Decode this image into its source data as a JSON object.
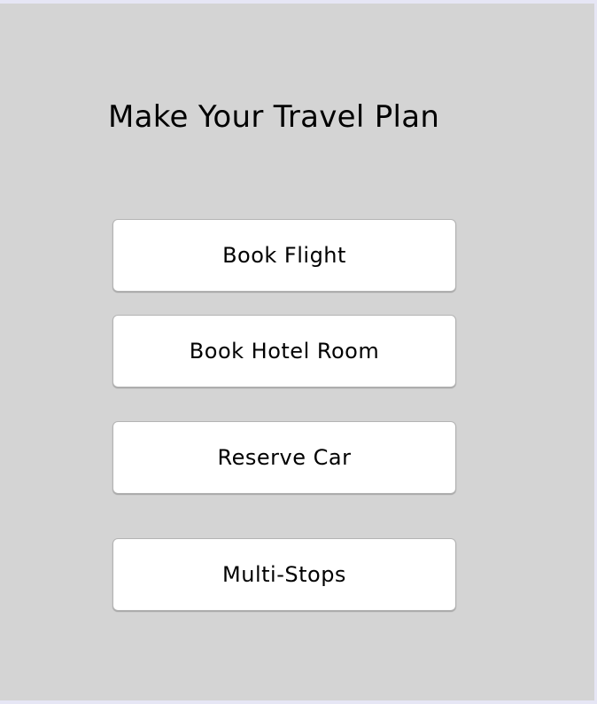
{
  "page": {
    "title": "Make Your Travel Plan"
  },
  "actions": {
    "book_flight": "Book Flight",
    "book_hotel_room": "Book Hotel Room",
    "reserve_car": "Reserve Car",
    "multi_stops": "Multi-Stops"
  },
  "colors": {
    "background": "#d4d4d4",
    "button_background": "#ffffff",
    "button_border": "#b4b4b4",
    "text": "#000000"
  }
}
